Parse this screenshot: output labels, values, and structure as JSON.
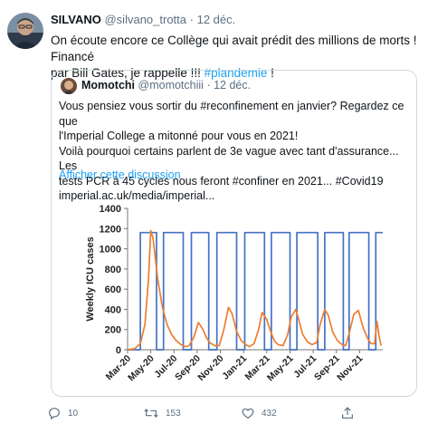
{
  "tweet": {
    "display_name": "SILVANO",
    "handle": "@silvano_trotta",
    "date": "12 déc.",
    "text_line1": "On écoute encore ce Collège qui avait prédit des millions de morts ! Financé",
    "text_line2_pre": "par Bill Gates, je rappelle !!! ",
    "hashtag": "#plandemie",
    "text_line2_post": " !"
  },
  "quote": {
    "display_name": "Momotchi",
    "handle": "@momotchiii",
    "date": "12 déc.",
    "lines": [
      "Vous pensiez vous sortir du #reconfinement en janvier? Regardez ce que",
      "l'Imperial College a mitonné pour vous en 2021!",
      "Voilà pourquoi certains parlent de 3e vague avec tant d'assurance... Les",
      "tests PCR à 45 cycles nous feront #confiner en 2021... #Covid19",
      "imperial.ac.uk/media/imperial..."
    ],
    "show_thread": "Afficher cette discussion"
  },
  "chart_data": {
    "type": "line",
    "ylabel": "Weekly ICU cases",
    "xlabel": "",
    "ylim": [
      0,
      1400
    ],
    "yticks": [
      0,
      200,
      400,
      600,
      800,
      1000,
      1200,
      1400
    ],
    "xticks": [
      "Mar-20",
      "May-20",
      "Jul-20",
      "Sep-20",
      "Nov-20",
      "Jan-21",
      "Mar-21",
      "May-21",
      "Jul-21",
      "Sep-21",
      "Nov-21"
    ],
    "x_month_range": [
      0,
      22
    ],
    "colors": {
      "capacity": "#4472c4",
      "cases": "#ed7d31"
    },
    "series": [
      {
        "key": "capacity",
        "x": [
          0,
          1.1,
          1.1,
          2.5,
          2.5,
          3.1,
          3.1,
          4.8,
          4.8,
          5.5,
          5.5,
          7.0,
          7.0,
          7.7,
          7.7,
          9.4,
          9.4,
          10.1,
          10.1,
          11.8,
          11.8,
          12.4,
          12.4,
          14.0,
          14.0,
          14.6,
          14.6,
          16.4,
          16.4,
          17.0,
          17.0,
          18.6,
          18.6,
          19.1,
          19.1,
          20.8,
          20.8,
          21.4,
          21.4,
          22
        ],
        "y": [
          0,
          0,
          1160,
          1160,
          0,
          0,
          1160,
          1160,
          0,
          0,
          1160,
          1160,
          0,
          0,
          1160,
          1160,
          0,
          0,
          1160,
          1160,
          0,
          0,
          1160,
          1160,
          0,
          0,
          1160,
          1160,
          0,
          0,
          1160,
          1160,
          0,
          0,
          1160,
          1160,
          0,
          0,
          1160,
          1160
        ]
      },
      {
        "key": "cases",
        "x": [
          0,
          0.6,
          1.1,
          1.5,
          1.8,
          2.0,
          2.2,
          2.6,
          3.0,
          3.4,
          3.8,
          4.2,
          4.6,
          5.0,
          5.3,
          5.7,
          6.1,
          6.5,
          6.8,
          7.1,
          7.5,
          7.9,
          8.3,
          8.7,
          9.0,
          9.4,
          9.8,
          10.2,
          10.5,
          10.9,
          11.3,
          11.6,
          12.0,
          12.4,
          12.7,
          13.0,
          13.4,
          13.8,
          14.1,
          14.5,
          14.8,
          15.1,
          15.5,
          15.9,
          16.3,
          16.6,
          17.0,
          17.3,
          17.7,
          18.1,
          18.5,
          18.8,
          19.1,
          19.5,
          19.9,
          20.3,
          20.7,
          21.0,
          21.3,
          21.5,
          21.7,
          21.85
        ],
        "y": [
          0,
          10,
          60,
          250,
          700,
          1180,
          1100,
          700,
          420,
          250,
          150,
          90,
          50,
          30,
          40,
          120,
          270,
          200,
          120,
          70,
          40,
          40,
          200,
          420,
          360,
          180,
          90,
          50,
          30,
          60,
          200,
          370,
          300,
          160,
          80,
          50,
          40,
          150,
          320,
          400,
          280,
          150,
          80,
          50,
          70,
          250,
          400,
          340,
          170,
          90,
          50,
          40,
          160,
          350,
          390,
          220,
          110,
          60,
          60,
          280,
          120,
          40
        ]
      }
    ]
  }
}
